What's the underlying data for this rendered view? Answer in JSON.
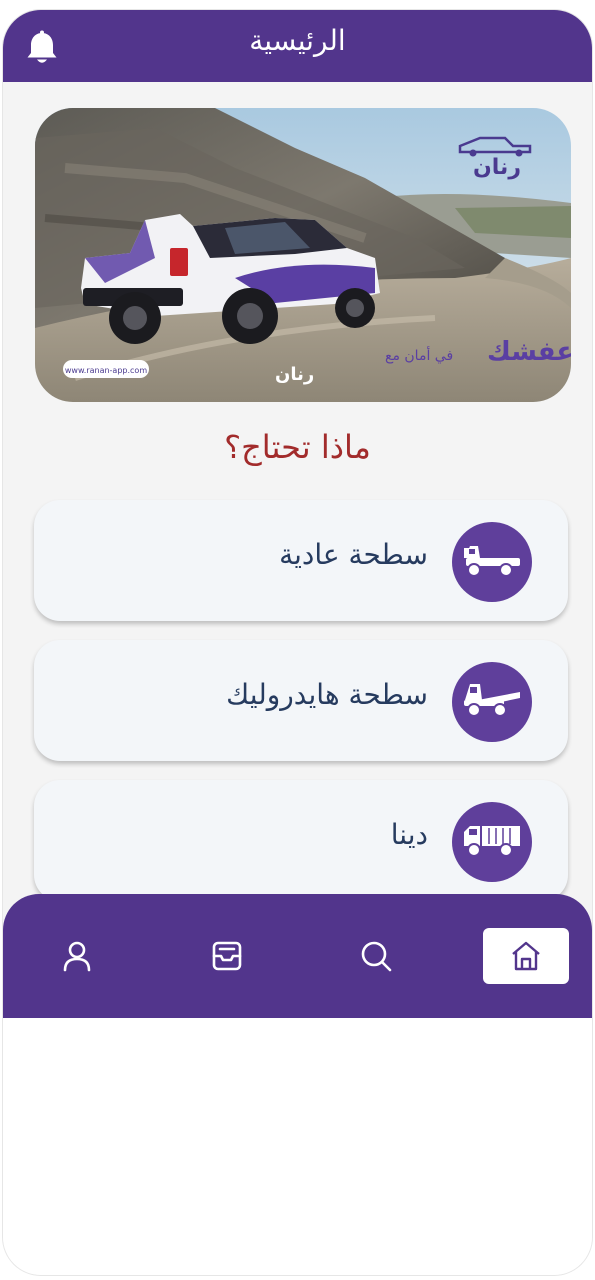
{
  "header": {
    "title": "الرئيسية",
    "notification_icon": "bell-icon"
  },
  "banner": {
    "logo_text": "رنان",
    "slogan_main": "عفشك",
    "slogan_rest": "في أمان مع",
    "slogan_brand": "رنان",
    "website": "www.ranan-app.com"
  },
  "section": {
    "title": "ماذا تحتاج؟"
  },
  "services": [
    {
      "label": "سطحة عادية",
      "icon": "flatbed-truck-icon"
    },
    {
      "label": "سطحة هايدروليك",
      "icon": "hydraulic-flatbed-truck-icon"
    },
    {
      "label": "دينا",
      "icon": "dyna-truck-icon"
    }
  ],
  "nav": {
    "items": [
      "profile-icon",
      "orders-inbox-icon",
      "search-icon",
      "home-icon"
    ],
    "active": "home-icon"
  },
  "colors": {
    "primary": "#52358c",
    "icon_circle": "#5f3f9b",
    "section_title": "#a22b2b",
    "card_text": "#263b5f",
    "card_bg": "#f3f6f9"
  }
}
